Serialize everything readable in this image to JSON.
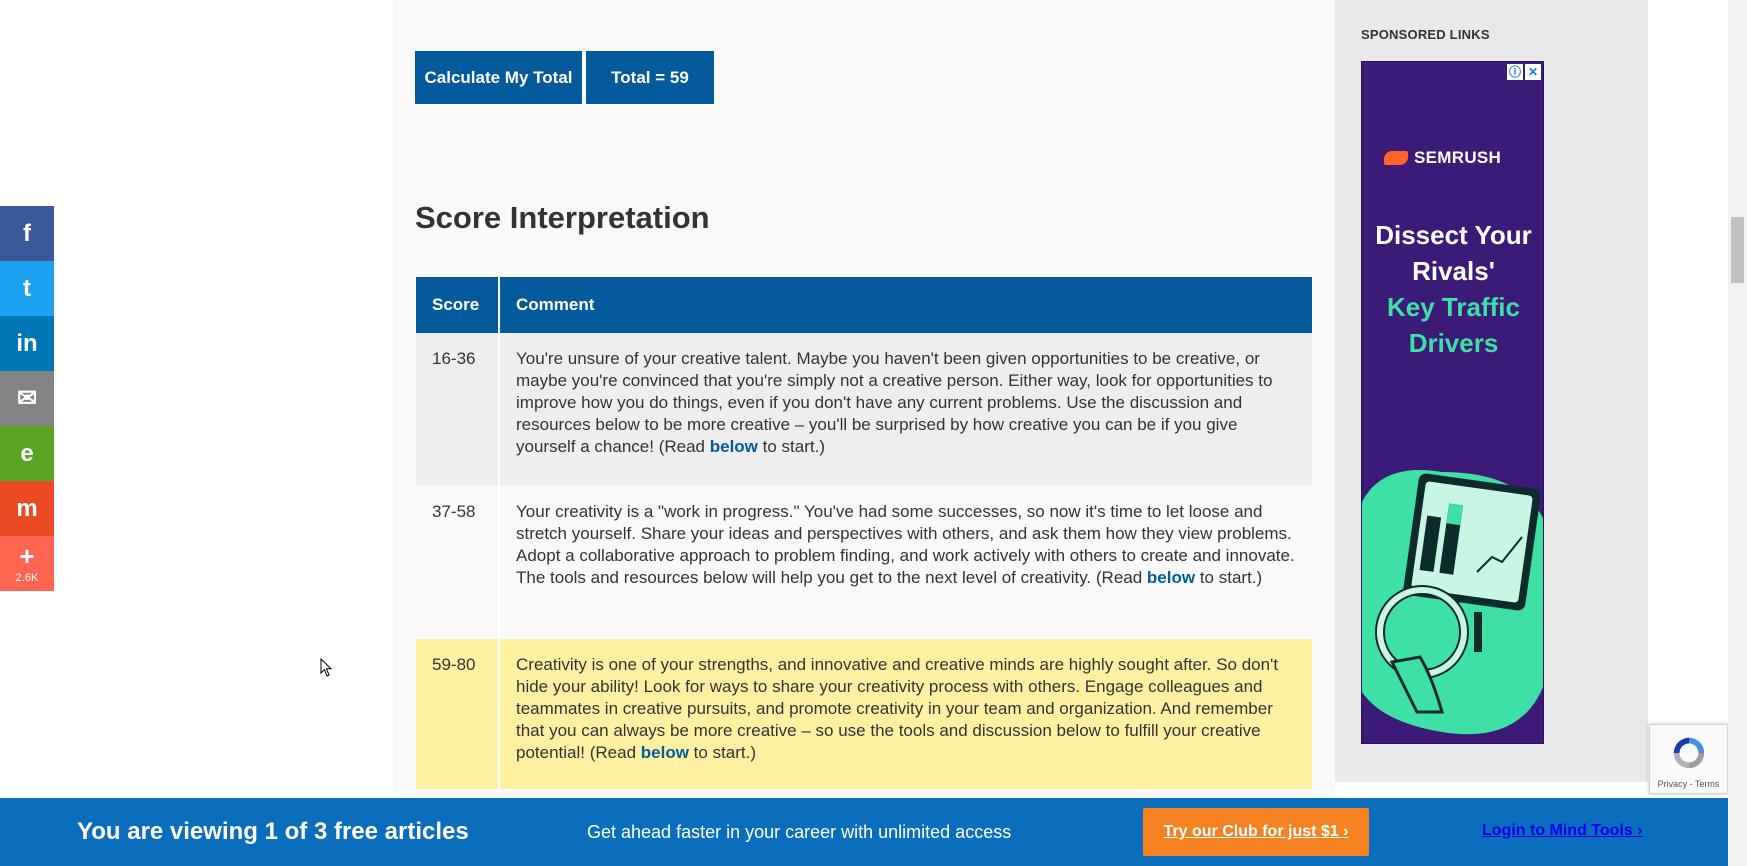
{
  "actions": {
    "calculate_label": "Calculate My Total",
    "total_label": "Total = 59"
  },
  "section": {
    "title": "Score Interpretation"
  },
  "table": {
    "headers": [
      "Score",
      "Comment"
    ],
    "rows": [
      {
        "score": "16-36",
        "comment": "You're unsure of your creative talent. Maybe you haven't been given opportunities to be creative, or maybe you're convinced that you're simply not a creative person. Either way, look for opportunities to improve how you do things, even if you don't have any current problems. Use the discussion and resources below to be more creative – you'll be surprised by how creative you can be if you give yourself a chance! (Read",
        "link": "below",
        "tail": "to start.)"
      },
      {
        "score": "37-58",
        "comment": "Your creativity is a \"work in progress.\" You've had some successes, so now it's time to let loose and stretch yourself. Share your ideas and perspectives with others, and ask them how they view problems. Adopt a collaborative approach to problem finding, and work actively with others to create and innovate. The tools and resources below will help you get to the next level of creativity. (Read",
        "link": "below",
        "tail": "to start.)"
      },
      {
        "score": "59-80",
        "comment": "Creativity is one of your strengths, and innovative and creative minds are highly sought after. So don't hide your ability! Look for ways to share your creativity process with others. Engage colleagues and teammates in creative pursuits, and promote creativity in your team and organization. And remember that you can always be more creative – so use the tools and discussion below to fulfill your creative potential! (Read",
        "link": "below",
        "tail": "to start.)"
      }
    ],
    "highlighted_row": 2
  },
  "sidebar": {
    "heading": "SPONSORED LINKS",
    "ad": {
      "brand": "SEMRUSH",
      "headline": "Dissect Your Rivals'",
      "highlight": "Key Traffic Drivers",
      "info_icon": "ⓘ",
      "close_icon": "✕"
    }
  },
  "recaptcha": {
    "text": "Privacy - Terms"
  },
  "social": {
    "facebook": "f",
    "twitter": "t",
    "linkedin": "in",
    "email": "✉",
    "evernote": "e",
    "mix": "m",
    "more": "+",
    "count": "2.6K"
  },
  "banner": {
    "title": "You are viewing 1 of 3 free articles",
    "subtitle": "Get ahead faster in your career with unlimited access",
    "cta": "Try our Club for just $1 ›",
    "login": "Login to Mind Tools ›"
  },
  "colors": {
    "primary": "#055a9c",
    "highlight_row": "#fdf1a1",
    "banner": "#0a6ebd",
    "cta": "#f58220",
    "ad_bg": "#3c1a78",
    "ad_green": "#3ee0a6"
  }
}
